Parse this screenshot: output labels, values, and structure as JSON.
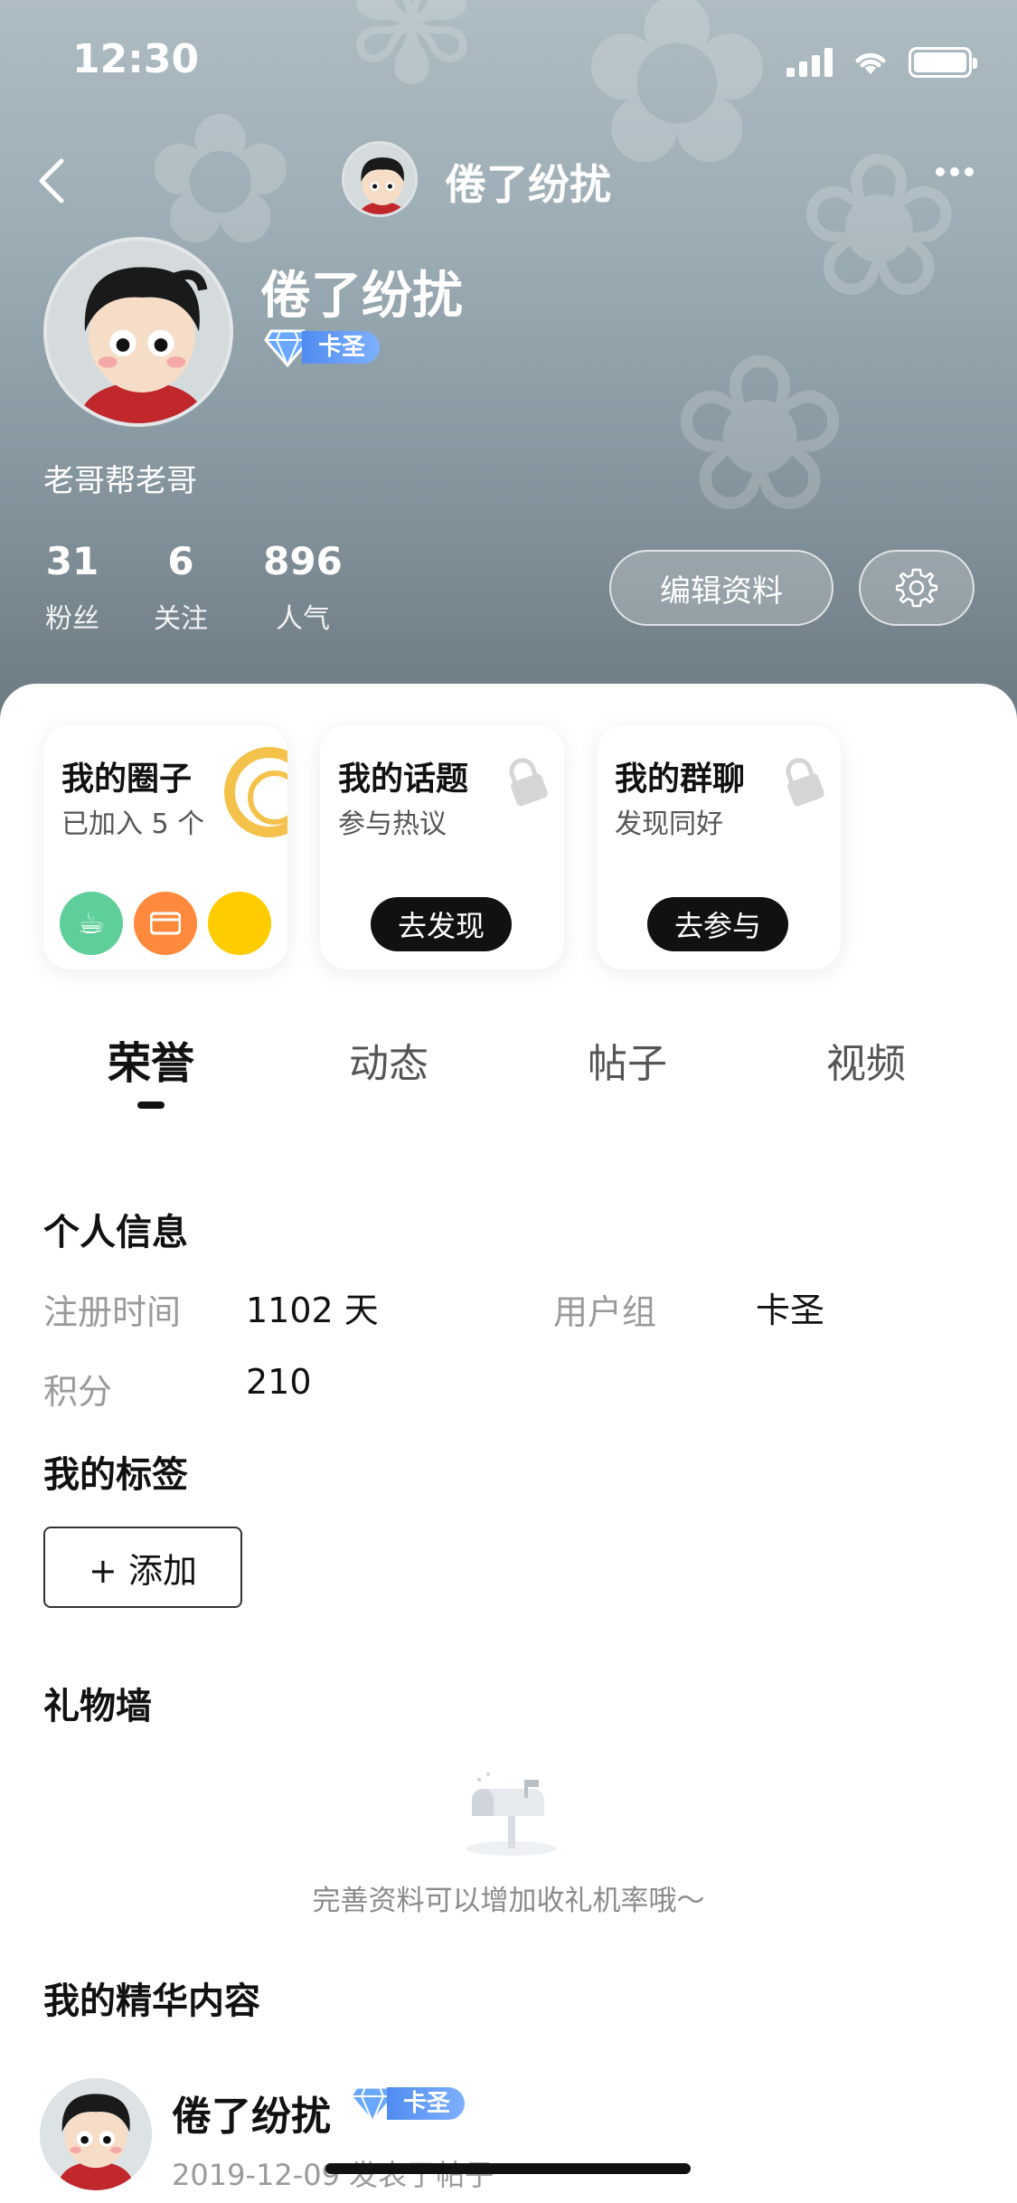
{
  "status_bar": {
    "time": "12:30"
  },
  "nav": {
    "title": "倦了纷扰"
  },
  "profile": {
    "name": "倦了纷扰",
    "level_badge": "卡圣",
    "bio": "老哥帮老哥",
    "stats": [
      {
        "value": "31",
        "label": "粉丝"
      },
      {
        "value": "6",
        "label": "关注"
      },
      {
        "value": "896",
        "label": "人气"
      }
    ],
    "edit_label": "编辑资料"
  },
  "cards": [
    {
      "title": "我的圈子",
      "subtitle": "已加入 5 个"
    },
    {
      "title": "我的话题",
      "subtitle": "参与热议",
      "button": "去发现"
    },
    {
      "title": "我的群聊",
      "subtitle": "发现同好",
      "button": "去参与"
    }
  ],
  "tabs": [
    {
      "label": "荣誉",
      "active": true
    },
    {
      "label": "动态",
      "active": false
    },
    {
      "label": "帖子",
      "active": false
    },
    {
      "label": "视频",
      "active": false
    }
  ],
  "personal_info": {
    "title": "个人信息",
    "register_label": "注册时间",
    "register_value": "1102 天",
    "group_label": "用户组",
    "group_value": "卡圣",
    "points_label": "积分",
    "points_value": "210"
  },
  "tags": {
    "title": "我的标签",
    "add_label": "+ 添加"
  },
  "gift_wall": {
    "title": "礼物墙",
    "empty_text": "完善资料可以增加收礼机率哦～"
  },
  "featured": {
    "title": "我的精华内容",
    "author": "倦了纷扰",
    "badge": "卡圣",
    "meta": "2019-12-09 发表了帖子"
  },
  "colors": {
    "badge_blue": "#4f8cf0",
    "ring_yellow": "#f4c24a",
    "mini_green": "#5fcf9a",
    "mini_orange": "#ff8a3d",
    "mini_yellow": "#ffcc00"
  }
}
